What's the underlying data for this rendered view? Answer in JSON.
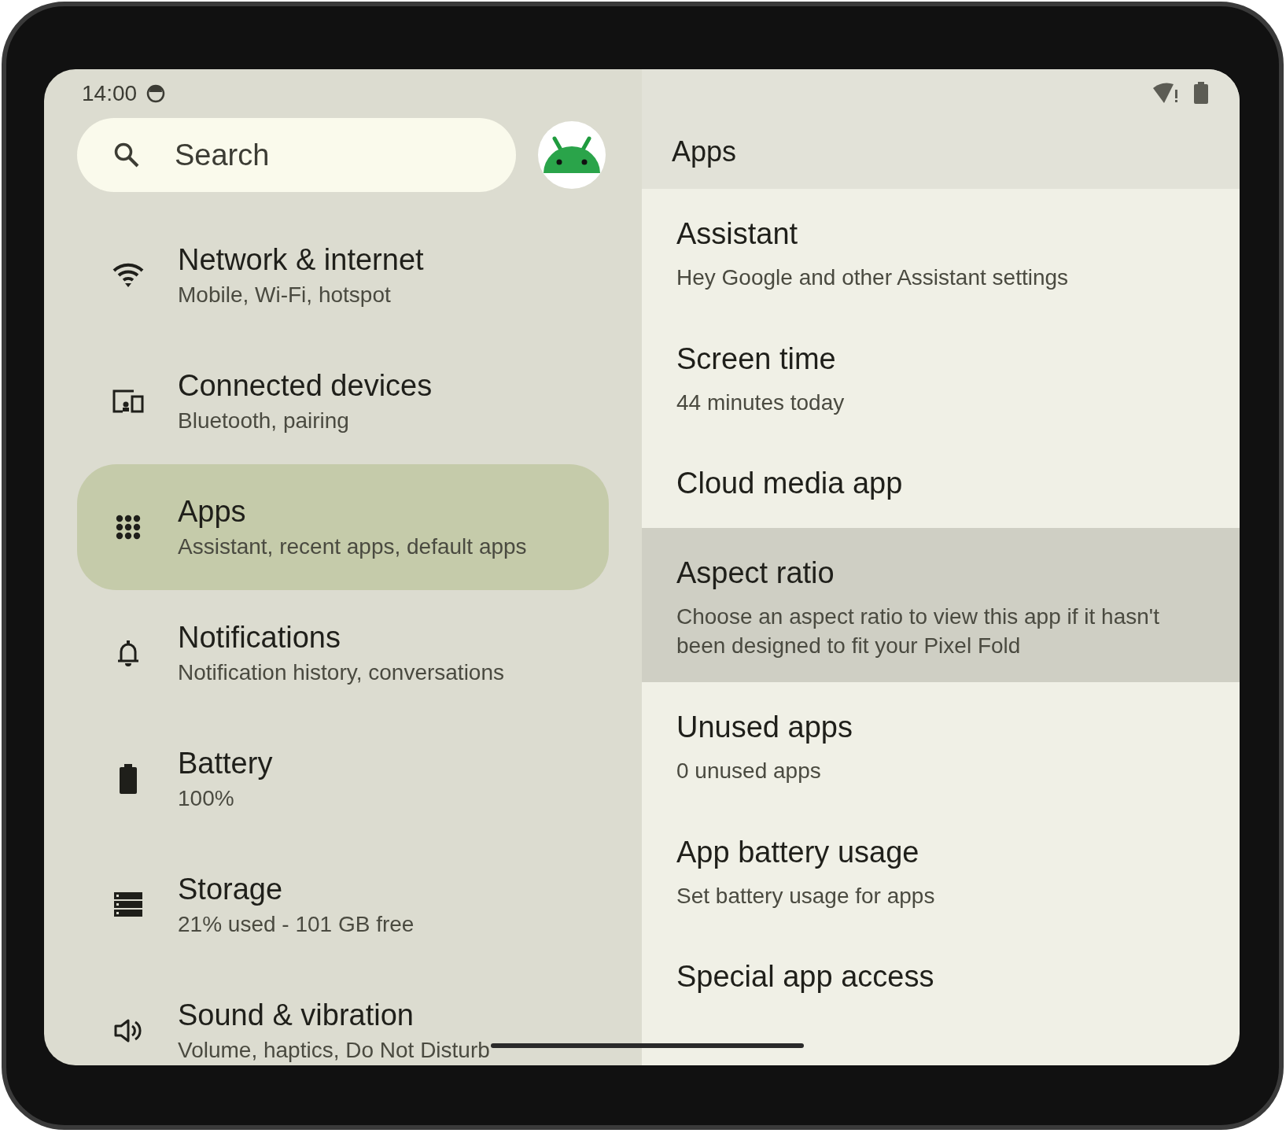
{
  "status_bar": {
    "time": "14:00"
  },
  "search": {
    "placeholder": "Search"
  },
  "menu": [
    {
      "kind": "wifi",
      "title": "Network & internet",
      "subtitle": "Mobile, Wi-Fi, hotspot",
      "selected": false
    },
    {
      "kind": "devices",
      "title": "Connected devices",
      "subtitle": "Bluetooth, pairing",
      "selected": false
    },
    {
      "kind": "apps",
      "title": "Apps",
      "subtitle": "Assistant, recent apps, default apps",
      "selected": true
    },
    {
      "kind": "bell",
      "title": "Notifications",
      "subtitle": "Notification history, conversations",
      "selected": false
    },
    {
      "kind": "battery",
      "title": "Battery",
      "subtitle": "100%",
      "selected": false
    },
    {
      "kind": "storage",
      "title": "Storage",
      "subtitle": "21% used - 101 GB free",
      "selected": false
    },
    {
      "kind": "sound",
      "title": "Sound & vibration",
      "subtitle": "Volume, haptics, Do Not Disturb",
      "selected": false
    }
  ],
  "detail": {
    "title": "Apps",
    "items": [
      {
        "title": "Assistant",
        "subtitle": "Hey Google and other Assistant settings",
        "selected": false
      },
      {
        "title": "Screen time",
        "subtitle": "44 minutes today",
        "selected": false
      },
      {
        "title": "Cloud media app",
        "selected": false
      },
      {
        "title": "Aspect ratio",
        "subtitle": "Choose an aspect ratio to view this app if it hasn't been designed to fit your Pixel Fold",
        "selected": true
      },
      {
        "title": "Unused apps",
        "subtitle": "0 unused apps",
        "selected": false
      },
      {
        "title": "App battery usage",
        "subtitle": "Set battery usage for apps",
        "selected": false
      },
      {
        "title": "Special app access",
        "selected": false
      }
    ]
  }
}
